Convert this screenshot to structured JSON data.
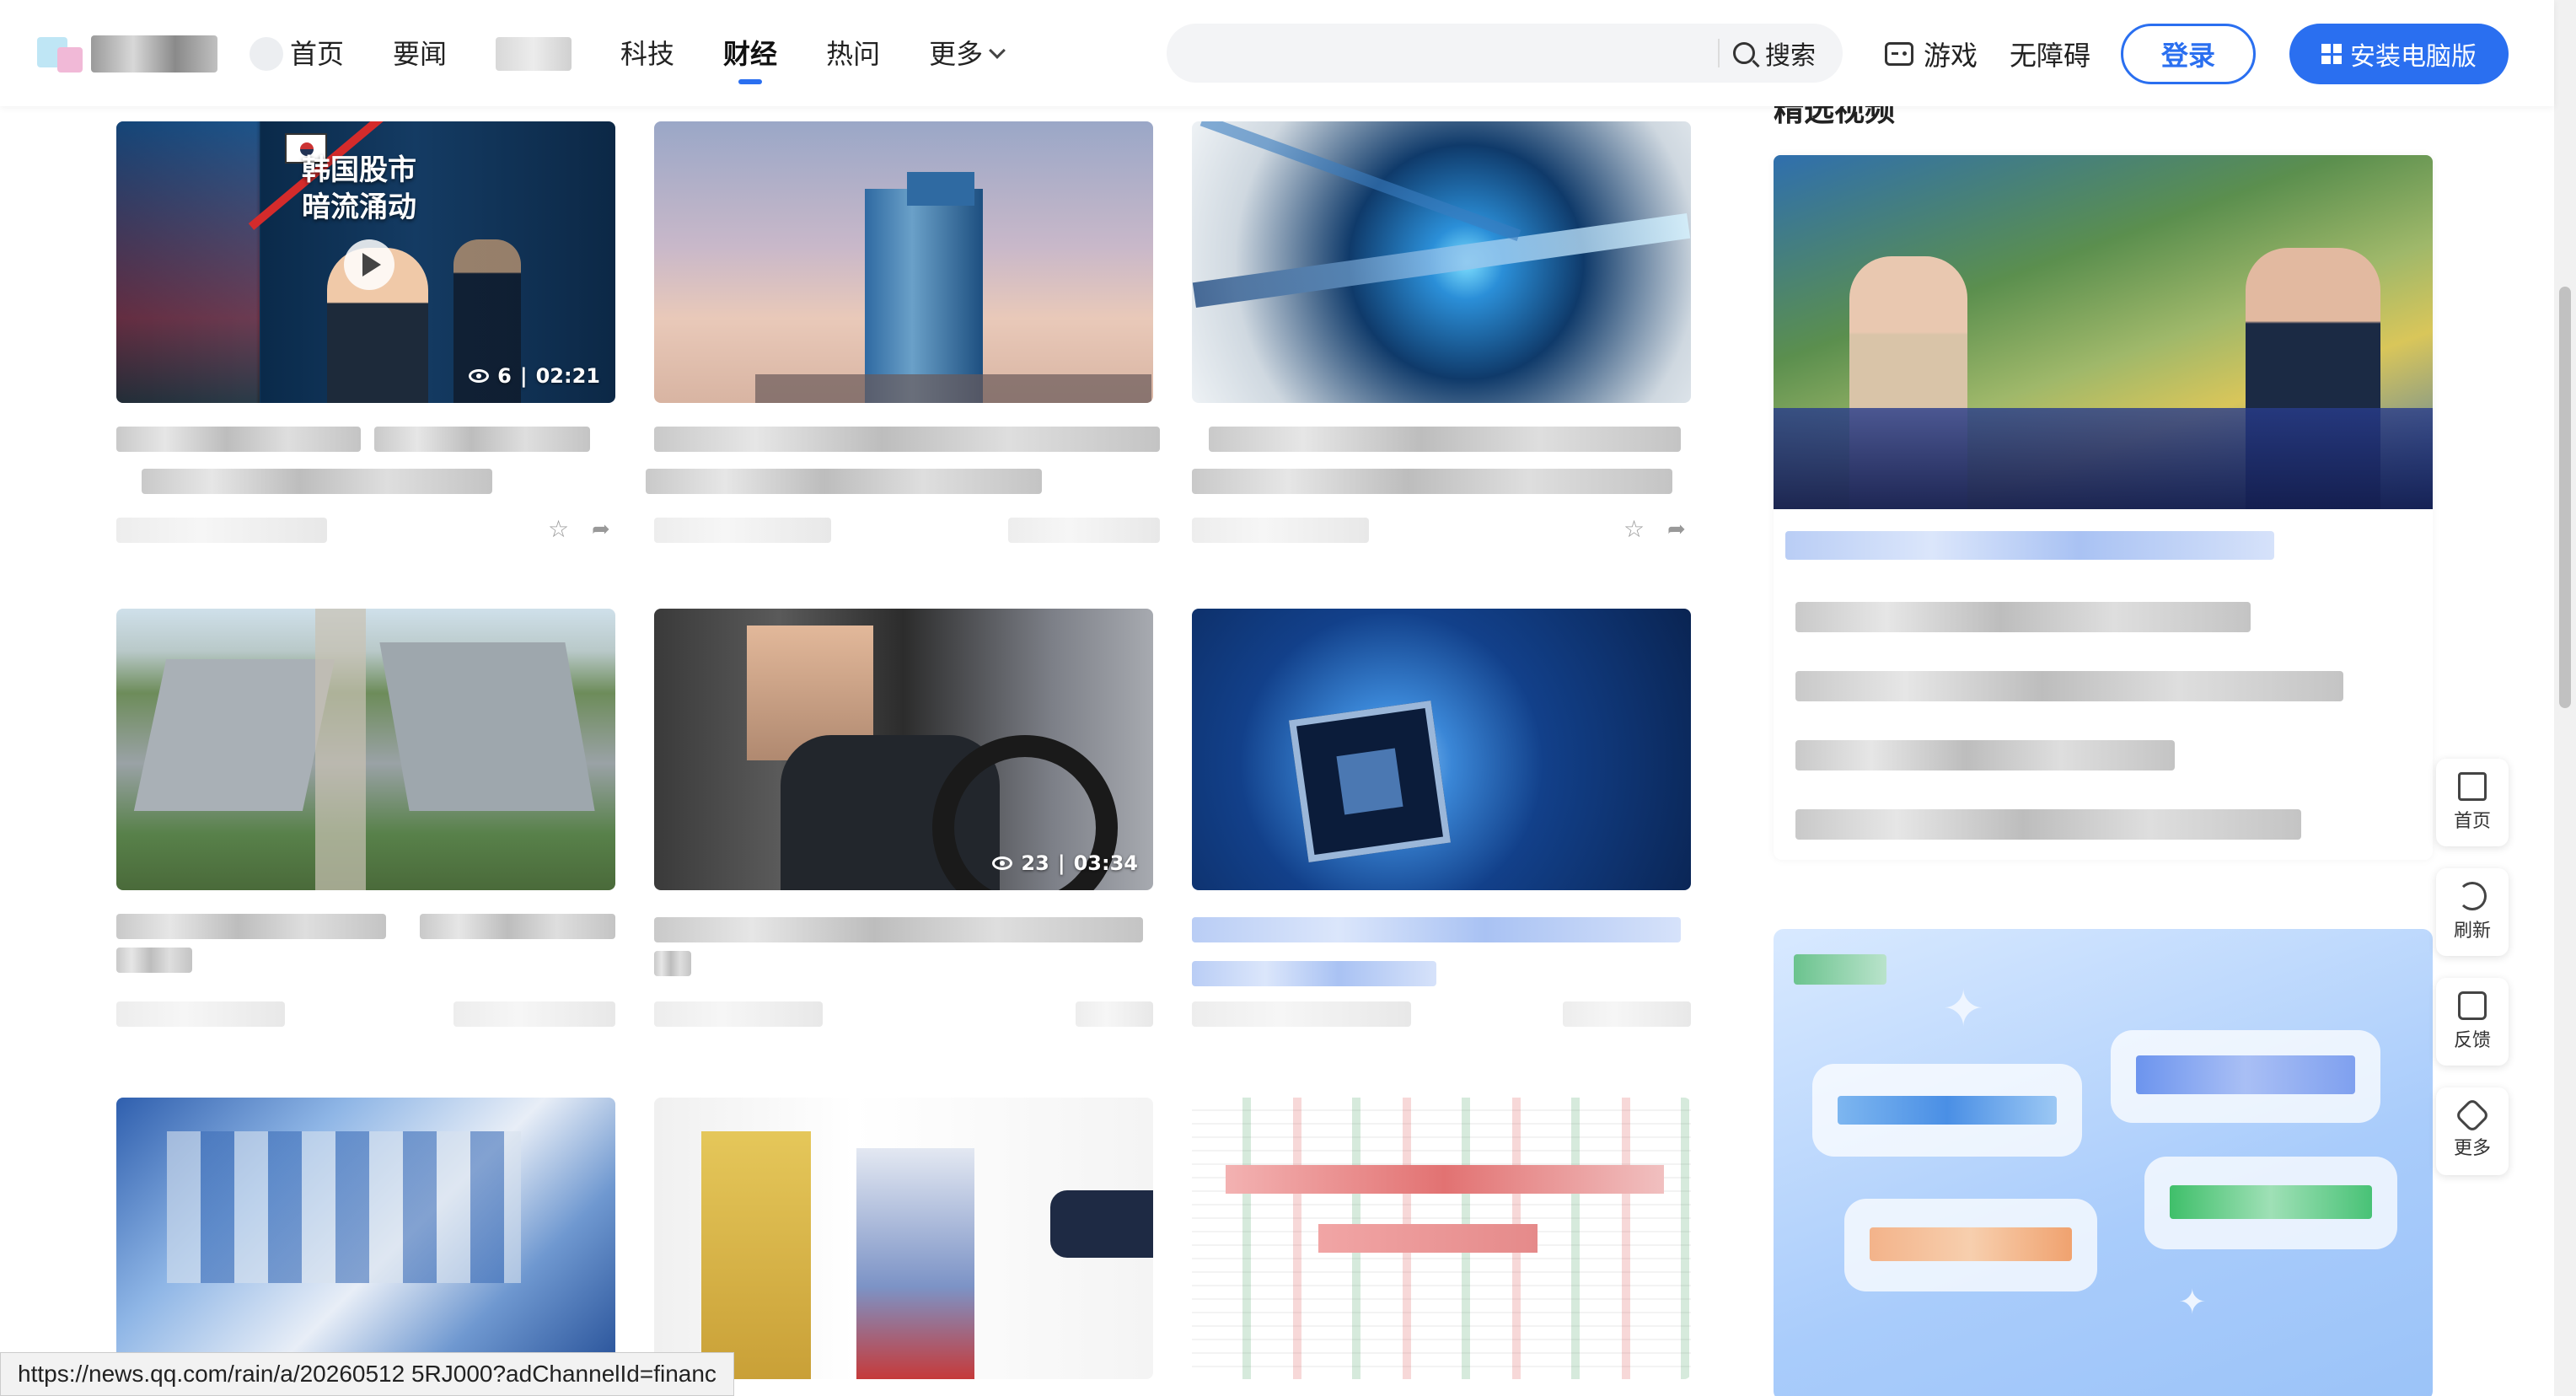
{
  "header": {
    "nav": [
      {
        "label": "首页"
      },
      {
        "label": "要闻"
      },
      {
        "label": "科技"
      },
      {
        "label": "财经"
      },
      {
        "label": "热问"
      },
      {
        "label": "更多"
      }
    ],
    "active_tab": "财经",
    "search": {
      "placeholder": "",
      "button_label": "搜索"
    },
    "games_label": "游戏",
    "accessibility_label": "无障碍",
    "login_label": "登录",
    "install_label": "安装电脑版",
    "accent_color": "#2a6ff0"
  },
  "main": {
    "cards": [
      {
        "overlay_title_line1": "韩国股市",
        "overlay_title_line2": "暗流涌动",
        "views": "6",
        "duration": "02:21"
      },
      {},
      {},
      {},
      {
        "views": "23",
        "duration": "03:34"
      },
      {},
      {},
      {},
      {}
    ]
  },
  "sidebar": {
    "section_title": "精选视频"
  },
  "float_tools": [
    {
      "label": "首页",
      "icon": "home-icon"
    },
    {
      "label": "刷新",
      "icon": "refresh-icon"
    },
    {
      "label": "反馈",
      "icon": "feedback-icon"
    },
    {
      "label": "更多",
      "icon": "more-icon"
    }
  ],
  "status_bar": {
    "url": "https://news.qq.com/rain/a/20260512 5RJ000?adChannelId=financ"
  }
}
